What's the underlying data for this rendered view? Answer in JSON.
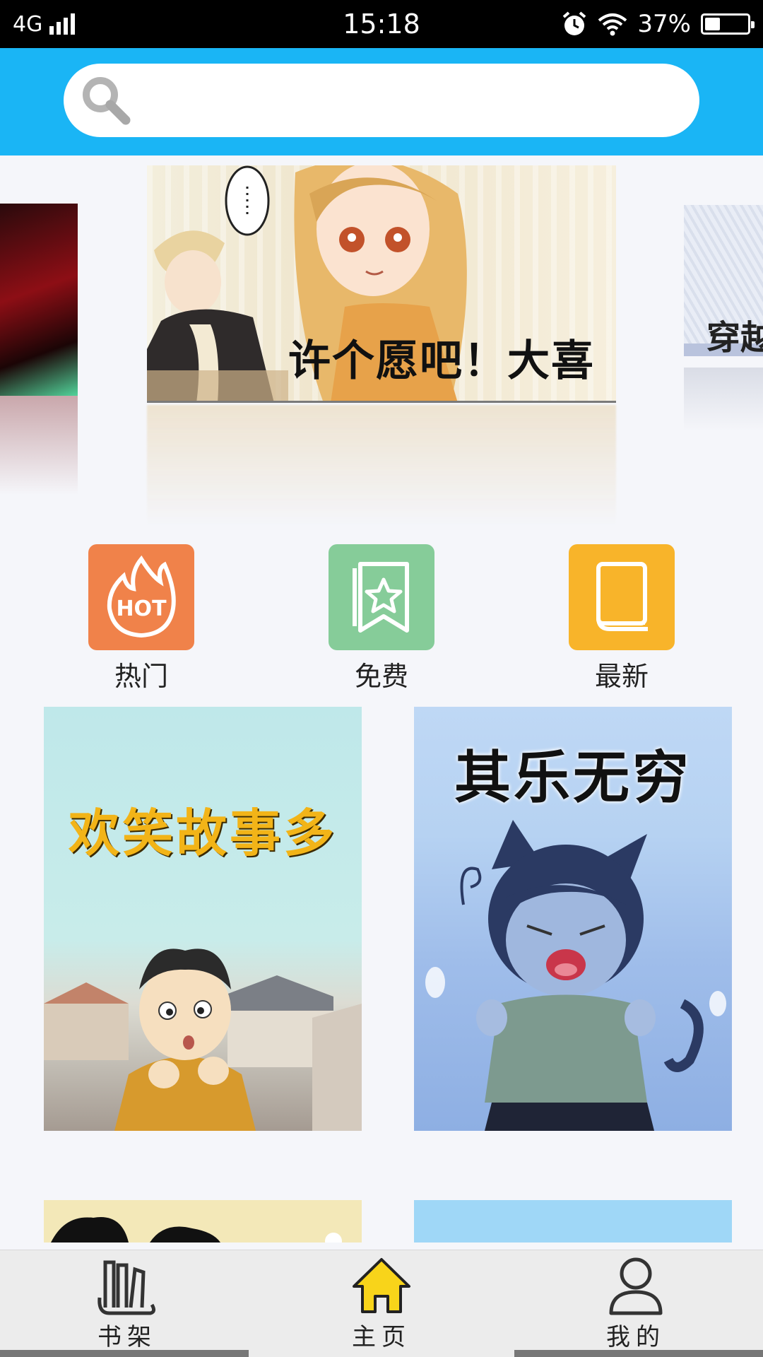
{
  "status_bar": {
    "network": "4G",
    "time": "15:18",
    "battery": "37%",
    "battery_level": 0.37
  },
  "search": {
    "placeholder": ""
  },
  "carousel": {
    "main_banner_caption": "许个愿吧！大喜",
    "right_banner_caption": "穿越"
  },
  "categories": [
    {
      "label": "热门",
      "icon": "hot-flame-icon",
      "color": "#f0824a"
    },
    {
      "label": "免费",
      "icon": "bookmark-star-icon",
      "color": "#86cc99"
    },
    {
      "label": "最新",
      "icon": "book-icon",
      "color": "#f8b42a"
    }
  ],
  "grid": {
    "cards": [
      {
        "title": "欢笑故事多"
      },
      {
        "title": "其乐无穷"
      },
      {
        "title": ""
      },
      {
        "title": ""
      }
    ]
  },
  "bottom_nav": {
    "items": [
      {
        "label": "书架",
        "icon": "bookshelf-icon"
      },
      {
        "label": "主页",
        "icon": "home-icon",
        "active": true
      },
      {
        "label": "我的",
        "icon": "user-icon"
      }
    ]
  },
  "colors": {
    "header": "#1ab5f5",
    "active_nav": "#f8d41a"
  }
}
